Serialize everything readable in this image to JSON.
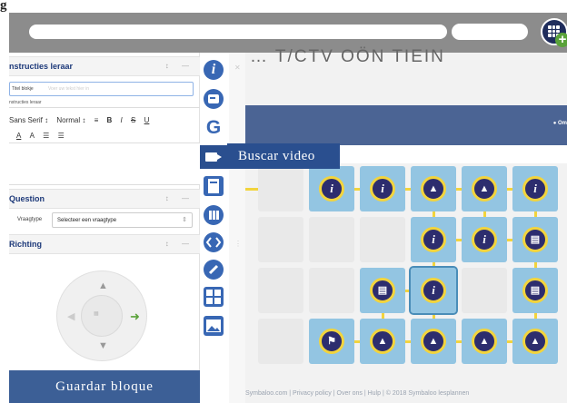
{
  "page": {
    "top_heading": "g"
  },
  "editor": {
    "section_instructions": "nstructies leraar",
    "title_label": "Titel blokje",
    "title_placeholder": "Voer uw tekst hier in",
    "instructions_label": "nstructies leraar",
    "toolbar": {
      "font": "Sans Serif",
      "size": "Normal",
      "sep": "↕",
      "align": "≡",
      "bold": "B",
      "italic": "I",
      "strike": "S",
      "underline": "U",
      "font_color": "A",
      "bg_color": "A",
      "list_ordered": "☰",
      "list_bullet": "☰"
    },
    "section_question": "Question",
    "vraagtype_label": "Vraagtype",
    "vraagtype_value": "Selecteer een vraagtype",
    "section_richting": "Richting",
    "save_button": "Guardar bloque",
    "section_ctrl": "↕ —"
  },
  "tools": {
    "info": "i",
    "google": "G",
    "video_tooltip": "Buscar video"
  },
  "board": {
    "title": "… T/CTV OÖN TIEIN",
    "nav_label": "● Om",
    "footer": "Symbaloo.com  |  Privacy policy  |  Over ons  |  Hulp  |  © 2018 Symbaloo lesplannen",
    "colors": {
      "node": "#2d2d6e",
      "ring": "#f2d43d",
      "tile": "#93c5e2",
      "nav": "#4b6494"
    }
  }
}
